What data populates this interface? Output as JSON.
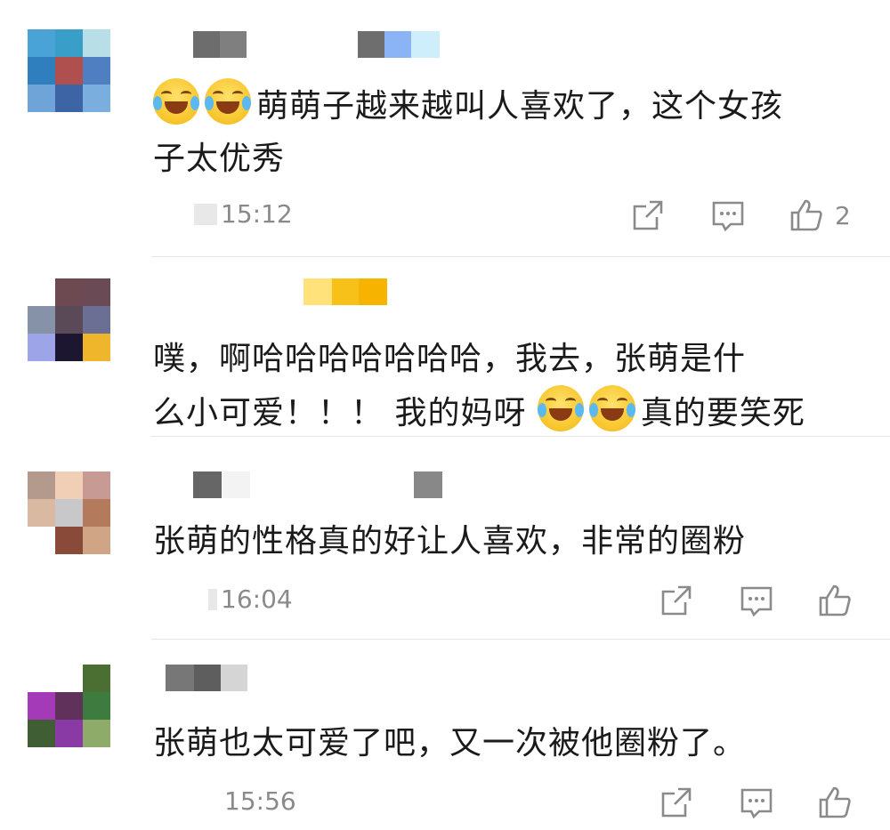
{
  "comments": [
    {
      "text_line1": "萌萌子越来越叫人喜欢了，这个女孩",
      "text_line2": "子太优秀",
      "time": "15:12",
      "likes": "2",
      "emoji": "laugh-tears",
      "avatar_colors": [
        "#4aa3d6",
        "#3a9fc8",
        "#b8dfe7",
        "#2f7fbf",
        "#b0504e",
        "#4f7fc0",
        "#6ea4d8",
        "#3d65a6",
        "#7aaede"
      ]
    },
    {
      "text_line1": "噗，啊哈哈哈哈哈哈哈，我去，张萌是什",
      "text_line2_a": "么小可爱！！！ 我的妈呀",
      "text_line2_b": "真的要笑死",
      "emoji": "cry-laugh",
      "avatar_colors": [
        "#ffffff",
        "#6d4a52",
        "#6a4b55",
        "#8592a8",
        "#5a4a58",
        "#6b6f94",
        "#9da5e8",
        "#1c1631",
        "#efb62c"
      ]
    },
    {
      "text": "张萌的性格真的好让人喜欢，非常的圈粉",
      "time": "16:04",
      "avatar_colors": [
        "#b39a8d",
        "#f1ceb6",
        "#c79a94",
        "#dab9a3",
        "#c8c7c9",
        "#b37b5c",
        "#ffffff",
        "#8a4a3a",
        "#cfa586"
      ]
    },
    {
      "text": "张萌也太可爱了吧，又一次被他圈粉了。",
      "time": "15:56",
      "avatar_colors": [
        "#ffffff",
        "#ffffff",
        "#4b6f33",
        "#a43ab8",
        "#60315a",
        "#3d7b3f",
        "#3f5e33",
        "#8a3aa5",
        "#8eab6a"
      ]
    }
  ],
  "colors": {
    "text": "#1a1a1a",
    "meta": "#8a8a8a",
    "divider": "#e6e6e6"
  }
}
